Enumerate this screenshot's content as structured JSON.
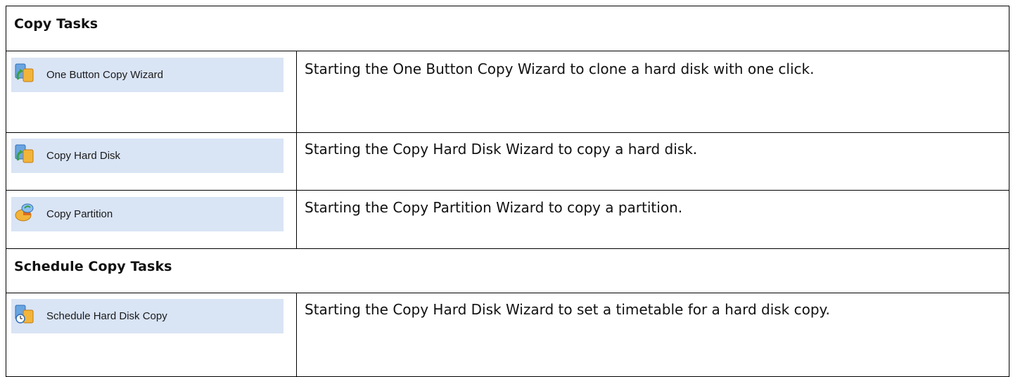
{
  "sections": [
    {
      "title": "Copy Tasks",
      "rows": [
        {
          "label": "One Button Copy Wizard",
          "icon": "copy-wizard-icon",
          "description": "Starting the One Button Copy Wizard to clone a hard disk with one click."
        },
        {
          "label": "Copy Hard Disk",
          "icon": "copy-hard-disk-icon",
          "description": "Starting the Copy Hard Disk Wizard to copy a hard disk."
        },
        {
          "label": "Copy Partition",
          "icon": "copy-partition-icon",
          "description": "Starting the Copy Partition Wizard to copy a partition."
        }
      ]
    },
    {
      "title": "Schedule Copy Tasks",
      "rows": [
        {
          "label": "Schedule Hard Disk Copy",
          "icon": "schedule-hard-disk-copy-icon",
          "description": "Starting the Copy Hard Disk Wizard to set a timetable for a hard disk copy."
        }
      ]
    }
  ],
  "colors": {
    "button_background": "#d9e4f5",
    "border": "#000000"
  }
}
